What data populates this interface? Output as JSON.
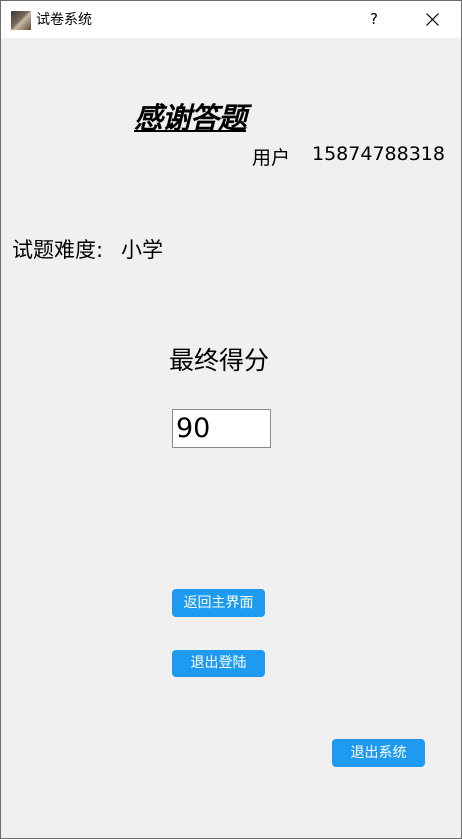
{
  "window": {
    "title": "试卷系统",
    "help_label": "?",
    "icon": "app-icon",
    "close_icon": "close-icon"
  },
  "main": {
    "thanks_title": "感谢答题",
    "user_label": "用户",
    "user_phone": "15874788318",
    "difficulty_label": "试题难度:",
    "difficulty_value": "小学",
    "score_heading": "最终得分",
    "score_value": "90"
  },
  "buttons": {
    "home_label": "返回主界面",
    "logout_label": "退出登陆",
    "exit_label": "退出系统",
    "accent_color": "#1e9bf0"
  }
}
